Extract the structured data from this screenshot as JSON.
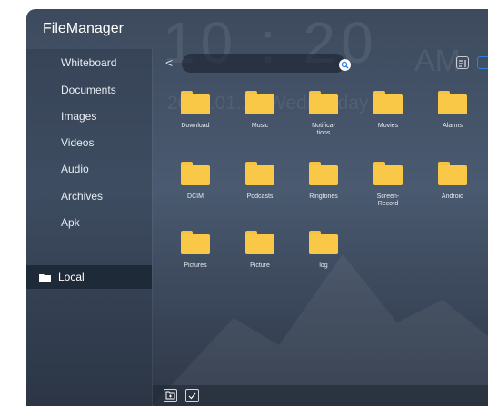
{
  "app": {
    "title": "FileManager"
  },
  "background": {
    "time": "10 : 20",
    "ampm": "AM",
    "date": "2025.01.15 Wednesday"
  },
  "sidebar": {
    "items": [
      {
        "label": "Whiteboard"
      },
      {
        "label": "Documents"
      },
      {
        "label": "Images"
      },
      {
        "label": "Videos"
      },
      {
        "label": "Audio"
      },
      {
        "label": "Archives"
      },
      {
        "label": "Apk"
      }
    ],
    "storage": {
      "label": "Local"
    }
  },
  "toolbar": {
    "back": "<"
  },
  "folders": [
    {
      "name": "Download"
    },
    {
      "name": "Music"
    },
    {
      "name": "Notifica-\ntions"
    },
    {
      "name": "Movies"
    },
    {
      "name": "Alarms"
    },
    {
      "name": "DCIM"
    },
    {
      "name": "Podcasts"
    },
    {
      "name": "Ringtones"
    },
    {
      "name": "Screen-\nRecord"
    },
    {
      "name": "Android"
    },
    {
      "name": "Pictures"
    },
    {
      "name": "Picture"
    },
    {
      "name": "log"
    }
  ],
  "colors": {
    "folder": "#f9c846",
    "selected_bg": "#1f2a38",
    "accent": "#2f7fe0"
  }
}
